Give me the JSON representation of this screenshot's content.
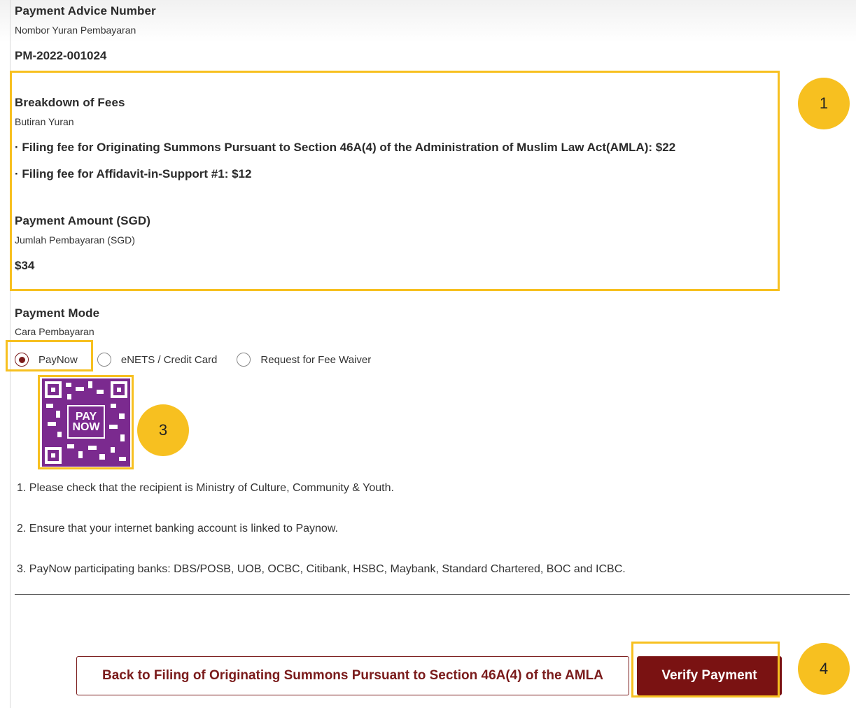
{
  "payment_advice": {
    "label_en": "Payment Advice Number",
    "label_ms": "Nombor Yuran Pembayaran",
    "value": "PM-2022-001024"
  },
  "fees": {
    "label_en": "Breakdown of Fees",
    "label_ms": "Butiran Yuran",
    "items": [
      "· Filing fee for Originating Summons Pursuant to Section 46A(4) of the Administration of Muslim Law Act(AMLA): $22",
      "· Filing fee for Affidavit-in-Support #1: $12"
    ]
  },
  "amount": {
    "label_en": "Payment Amount (SGD)",
    "label_ms": "Jumlah Pembayaran (SGD)",
    "value": "$34"
  },
  "payment_mode": {
    "label_en": "Payment Mode",
    "label_ms": "Cara Pembayaran",
    "options": [
      {
        "label": "PayNow",
        "selected": true
      },
      {
        "label": "eNETS / Credit Card",
        "selected": false
      },
      {
        "label": "Request for Fee Waiver",
        "selected": false
      }
    ]
  },
  "qr": {
    "logo_line1": "PAY",
    "logo_line2": "NOW",
    "icon": "paynow-qr-icon"
  },
  "notes": [
    "1. Please check that the recipient is Ministry of Culture, Community & Youth.",
    "2. Ensure that your internet banking account is linked to Paynow.",
    "3. PayNow participating banks: DBS/POSB, UOB, OCBC, Citibank, HSBC, Maybank, Standard Chartered, BOC and ICBC."
  ],
  "buttons": {
    "back": "Back to Filing of Originating Summons Pursuant to Section 46A(4) of the AMLA",
    "verify": "Verify Payment"
  },
  "callouts": [
    "1",
    "3",
    "4"
  ],
  "colors": {
    "accent": "#7a1212",
    "highlight": "#f7c020",
    "paynow": "#7b2a8f"
  }
}
